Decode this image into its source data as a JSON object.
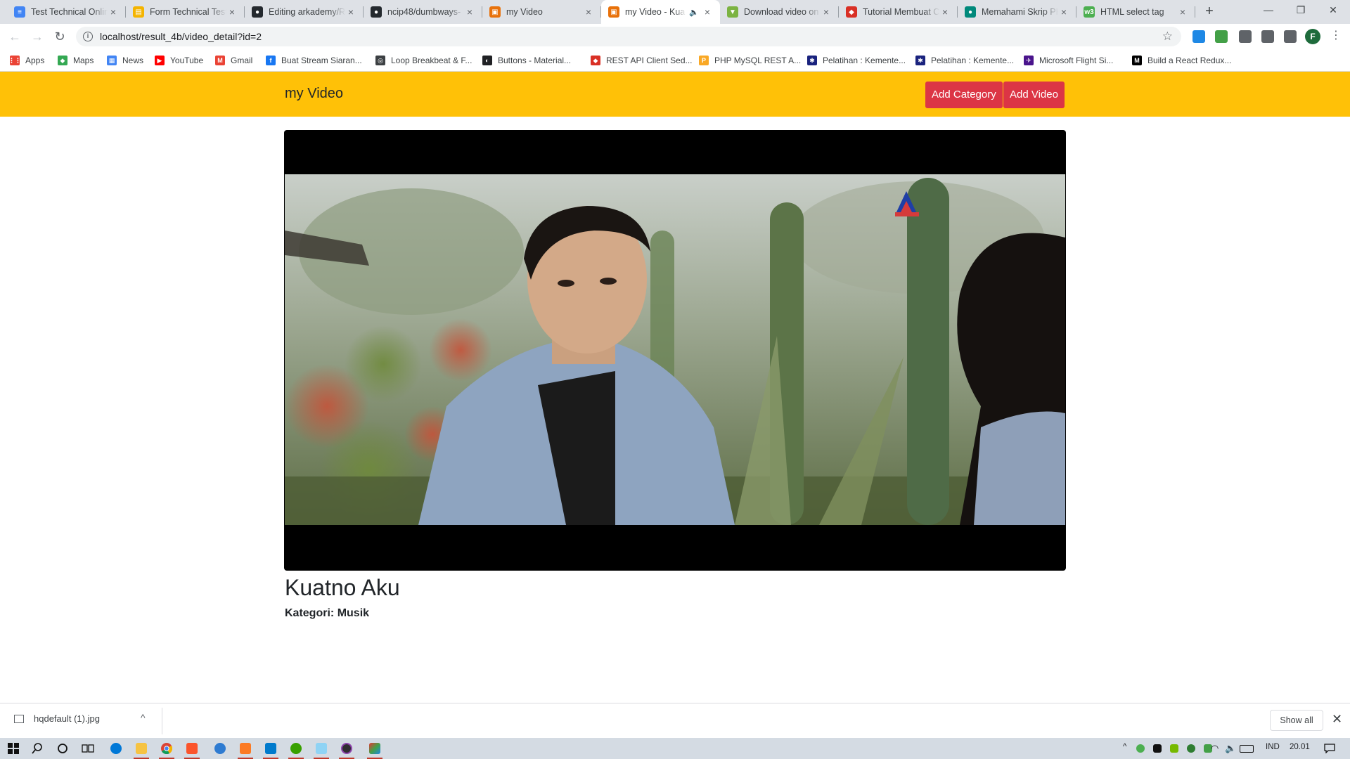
{
  "browser": {
    "tabs": [
      {
        "title": "Test Technical Online",
        "favicon_color": "#4285f4",
        "favicon_glyph": "≡",
        "icon": "docs-icon"
      },
      {
        "title": "Form Technical Test",
        "favicon_color": "#f4b400",
        "favicon_glyph": "▤",
        "icon": "form-icon"
      },
      {
        "title": "Editing arkademy/R",
        "favicon_color": "#24292e",
        "favicon_glyph": "●",
        "icon": "github-icon"
      },
      {
        "title": "ncip48/dumbways-",
        "favicon_color": "#24292e",
        "favicon_glyph": "●",
        "icon": "github-icon"
      },
      {
        "title": "my Video",
        "favicon_color": "#e8710a",
        "favicon_glyph": "▣",
        "icon": "xampp-icon"
      },
      {
        "title": "my Video - Kua",
        "favicon_color": "#e8710a",
        "favicon_glyph": "▣",
        "icon": "xampp-icon",
        "active": true,
        "audio": "🔈"
      },
      {
        "title": "Download video on",
        "favicon_color": "#7cb342",
        "favicon_glyph": "▼",
        "icon": "download-site-icon"
      },
      {
        "title": "Tutorial Membuat C",
        "favicon_color": "#d93025",
        "favicon_glyph": "◆",
        "icon": "tutorial-icon"
      },
      {
        "title": "Memahami Skrip PH",
        "favicon_color": "#00897b",
        "favicon_glyph": "●",
        "icon": "site-icon"
      },
      {
        "title": "HTML select tag",
        "favicon_color": "#4caf50",
        "favicon_glyph": "w3",
        "icon": "w3schools-icon"
      }
    ],
    "close_glyph": "×",
    "new_tab_glyph": "+",
    "window_controls": {
      "minimize": "—",
      "restore": "❐",
      "close": "✕"
    },
    "toolbar": {
      "back": "←",
      "forward": "→",
      "reload": "↻",
      "info_glyph": "i",
      "url": "localhost/result_4b/video_detail?id=2",
      "star": "☆",
      "profile_initial": "F",
      "menu": "⋮"
    },
    "extensions": [
      {
        "name": "extension-1-icon",
        "color": "#1e88e5"
      },
      {
        "name": "extension-2-icon",
        "color": "#43a047"
      },
      {
        "name": "extension-3-icon",
        "color": "#5f6368"
      },
      {
        "name": "extensions-puzzle-icon",
        "color": "#5f6368"
      },
      {
        "name": "media-controls-icon",
        "color": "#5f6368"
      }
    ],
    "bookmarks": [
      {
        "label": "Apps",
        "color": "#ea4335",
        "glyph": "⋮⋮",
        "icon": "apps-icon"
      },
      {
        "label": "Maps",
        "color": "#34a853",
        "glyph": "◆",
        "icon": "maps-icon"
      },
      {
        "label": "News",
        "color": "#4285f4",
        "glyph": "▦",
        "icon": "news-icon"
      },
      {
        "label": "YouTube",
        "color": "#ff0000",
        "glyph": "▶",
        "icon": "youtube-icon"
      },
      {
        "label": "Gmail",
        "color": "#ea4335",
        "glyph": "M",
        "icon": "gmail-icon"
      },
      {
        "label": "Buat Stream Siaran...",
        "color": "#1877f2",
        "glyph": "f",
        "icon": "facebook-icon"
      },
      {
        "label": "Loop Breakbeat & F...",
        "color": "#3c4043",
        "glyph": "◎",
        "icon": "web-icon"
      },
      {
        "label": "Buttons - Material...",
        "color": "#202124",
        "glyph": "◐",
        "icon": "material-icon"
      },
      {
        "label": "REST API Client Sed...",
        "color": "#d93025",
        "glyph": "◆",
        "icon": "rest-api-icon"
      },
      {
        "label": "PHP MySQL REST A...",
        "color": "#f9a825",
        "glyph": "P",
        "icon": "php-icon"
      },
      {
        "label": "Pelatihan : Kemente...",
        "color": "#1a237e",
        "glyph": "✱",
        "icon": "pelatihan-icon"
      },
      {
        "label": "Pelatihan : Kemente...",
        "color": "#1a237e",
        "glyph": "✱",
        "icon": "pelatihan-icon"
      },
      {
        "label": "Microsoft Flight Si...",
        "color": "#4a148c",
        "glyph": "✈",
        "icon": "flight-sim-icon"
      },
      {
        "label": "Build a React Redux...",
        "color": "#000000",
        "glyph": "M",
        "icon": "medium-icon"
      }
    ]
  },
  "app": {
    "brand": "my Video",
    "buttons": {
      "add_category": "Add Category",
      "add_video": "Add Video"
    },
    "colors": {
      "navbar": "#ffc107",
      "button": "#dc3545"
    },
    "video": {
      "title": "Kuatno Aku",
      "category_label": "Kategori:",
      "category": "Musik"
    }
  },
  "downloads": {
    "file": "hqdefault (1).jpg",
    "caret": "^",
    "show_all": "Show all",
    "close": "✕"
  },
  "taskbar": {
    "tray": {
      "language": "IND",
      "time": "20.01"
    }
  }
}
